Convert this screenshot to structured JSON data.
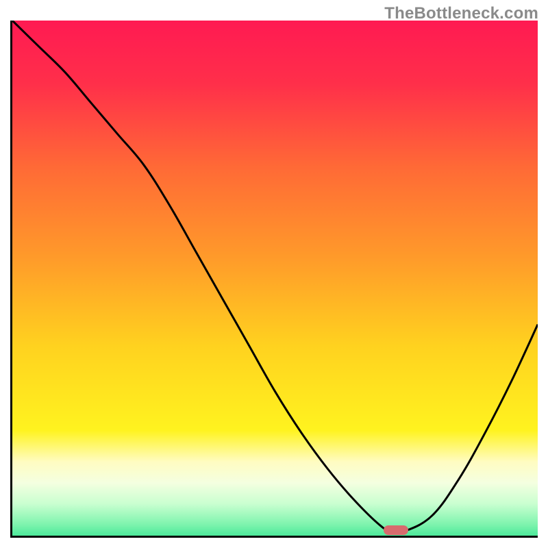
{
  "watermark": "TheBottleneck.com",
  "chart_data": {
    "type": "line",
    "title": "",
    "xlabel": "",
    "ylabel": "",
    "xlim": [
      0,
      100
    ],
    "ylim": [
      0,
      100
    ],
    "x": [
      0,
      5,
      10,
      15,
      20,
      25,
      30,
      35,
      40,
      45,
      50,
      55,
      60,
      65,
      70,
      72,
      75,
      80,
      85,
      90,
      95,
      100
    ],
    "values": [
      100,
      95,
      90,
      84,
      78,
      72,
      64,
      55,
      46,
      37,
      28,
      20,
      13,
      7,
      2,
      1,
      1,
      4,
      11,
      20,
      30,
      41
    ],
    "marker": {
      "x": 73,
      "y": 1
    },
    "gradient_stops": [
      {
        "pos": 0.0,
        "color": "#ff1a52"
      },
      {
        "pos": 0.12,
        "color": "#ff2f4a"
      },
      {
        "pos": 0.28,
        "color": "#ff6a36"
      },
      {
        "pos": 0.45,
        "color": "#ff9a2a"
      },
      {
        "pos": 0.62,
        "color": "#ffd21f"
      },
      {
        "pos": 0.78,
        "color": "#fff31f"
      },
      {
        "pos": 0.84,
        "color": "#fffcc2"
      },
      {
        "pos": 0.88,
        "color": "#f4ffe0"
      },
      {
        "pos": 0.92,
        "color": "#c9ffd0"
      },
      {
        "pos": 0.96,
        "color": "#7cf3ad"
      },
      {
        "pos": 1.0,
        "color": "#1ee089"
      }
    ],
    "marker_color": "#d86a6d",
    "curve_color": "#000000"
  }
}
